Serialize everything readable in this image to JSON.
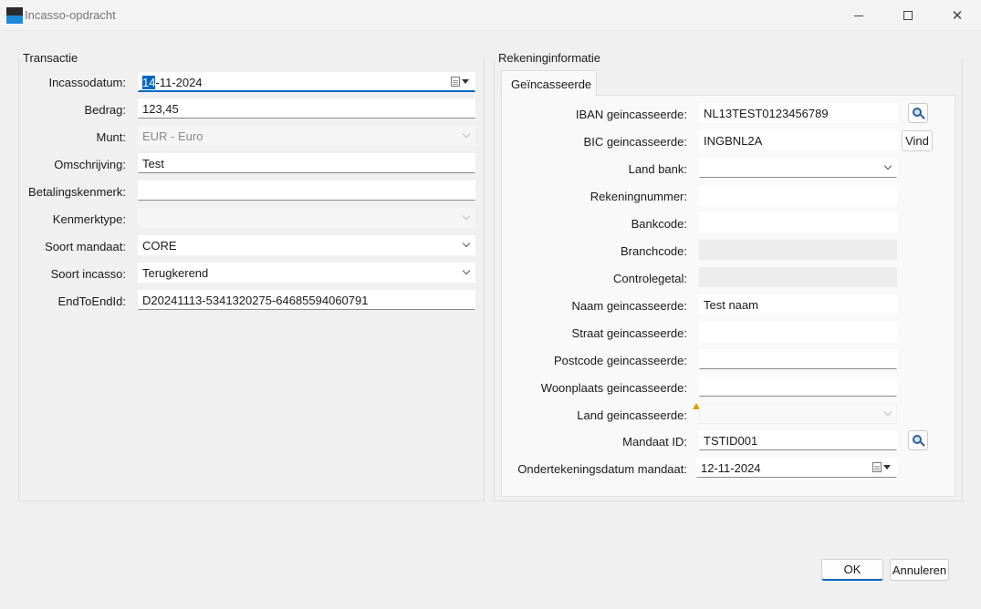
{
  "window": {
    "title": "Incasso-opdracht",
    "controls": {
      "minimize_icon": "minimize-icon",
      "maximize_icon": "maximize-icon",
      "close_icon": "close-icon",
      "close_glyph": "✕"
    }
  },
  "transactie": {
    "group_label": "Transactie",
    "fields": {
      "incassodatum": {
        "label": "Incassodatum:",
        "value_selected": "14",
        "value_rest": "-11-2024"
      },
      "bedrag": {
        "label": "Bedrag:",
        "value": "123,45"
      },
      "munt": {
        "label": "Munt:",
        "value": "EUR - Euro"
      },
      "omschrijving": {
        "label": "Omschrijving:",
        "value": "Test"
      },
      "betalingskenmerk": {
        "label": "Betalingskenmerk:",
        "value": ""
      },
      "kenmerktype": {
        "label": "Kenmerktype:",
        "value": ""
      },
      "soort_mandaat": {
        "label": "Soort mandaat:",
        "value": "CORE"
      },
      "soort_incasso": {
        "label": "Soort incasso:",
        "value": "Terugkerend"
      },
      "end_to_end_id": {
        "label": "EndToEndId:",
        "value": "D20241113-5341320275-64685594060791"
      }
    }
  },
  "rekeninginformatie": {
    "group_label": "Rekeninginformatie",
    "tab_label": "Geïncasseerde",
    "fields": {
      "iban": {
        "label": "IBAN geincasseerde:",
        "value": "NL13TEST0123456789"
      },
      "bic": {
        "label": "BIC geincasseerde:",
        "value": "INGBNL2A",
        "button": "Vind"
      },
      "land_bank": {
        "label": "Land bank:",
        "value": ""
      },
      "rekeningnummer": {
        "label": "Rekeningnummer:",
        "value": ""
      },
      "bankcode": {
        "label": "Bankcode:",
        "value": ""
      },
      "branchcode": {
        "label": "Branchcode:",
        "value": ""
      },
      "controlegetal": {
        "label": "Controlegetal:",
        "value": ""
      },
      "naam": {
        "label": "Naam geincasseerde:",
        "value": "Test naam"
      },
      "straat": {
        "label": "Straat geincasseerde:",
        "value": ""
      },
      "postcode": {
        "label": "Postcode geincasseerde:",
        "value": ""
      },
      "woonplaats": {
        "label": "Woonplaats geincasseerde:",
        "value": ""
      },
      "land": {
        "label": "Land geincasseerde:",
        "value": ""
      },
      "mandaat_id": {
        "label": "Mandaat ID:",
        "value": "TSTID001"
      },
      "ondertekeningsdatum": {
        "label": "Ondertekeningsdatum mandaat:",
        "value": "12-11-2024"
      }
    }
  },
  "footer": {
    "ok_label": "OK",
    "cancel_label": "Annuleren"
  },
  "colors": {
    "accent": "#0067c0",
    "warning": "#e0a000"
  }
}
